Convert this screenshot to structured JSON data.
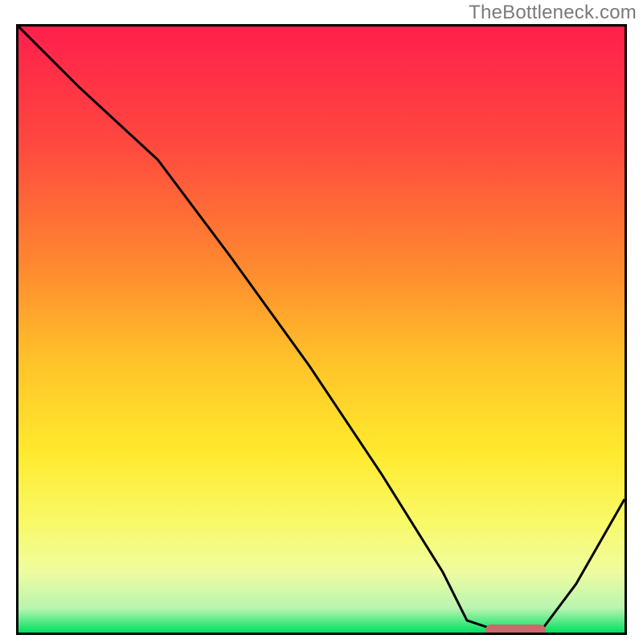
{
  "watermark": "TheBottleneck.com",
  "chart_data": {
    "type": "line",
    "title": "",
    "xlabel": "",
    "ylabel": "",
    "xlim": [
      0,
      100
    ],
    "ylim": [
      0,
      100
    ],
    "grid": false,
    "legend": false,
    "background_gradient": {
      "stops": [
        {
          "pos": 0.0,
          "color": "#ff1f4b"
        },
        {
          "pos": 0.2,
          "color": "#ff4a3f"
        },
        {
          "pos": 0.4,
          "color": "#ff8a2f"
        },
        {
          "pos": 0.55,
          "color": "#ffc229"
        },
        {
          "pos": 0.7,
          "color": "#ffe92d"
        },
        {
          "pos": 0.82,
          "color": "#f8fa69"
        },
        {
          "pos": 0.9,
          "color": "#effc9f"
        },
        {
          "pos": 0.96,
          "color": "#b8f5b0"
        },
        {
          "pos": 1.0,
          "color": "#00e060"
        }
      ]
    },
    "series": [
      {
        "name": "bottleneck-curve",
        "x": [
          0,
          10,
          23,
          35,
          48,
          60,
          70,
          74,
          80,
          86,
          92,
          100
        ],
        "y": [
          100,
          90,
          78,
          62,
          44,
          26,
          10,
          2,
          0,
          0,
          8,
          22
        ]
      }
    ],
    "annotations": [
      {
        "name": "optimal-range-marker",
        "type": "bar",
        "x_start": 77,
        "x_end": 87,
        "y": 0,
        "color": "#c96b6b"
      }
    ]
  }
}
